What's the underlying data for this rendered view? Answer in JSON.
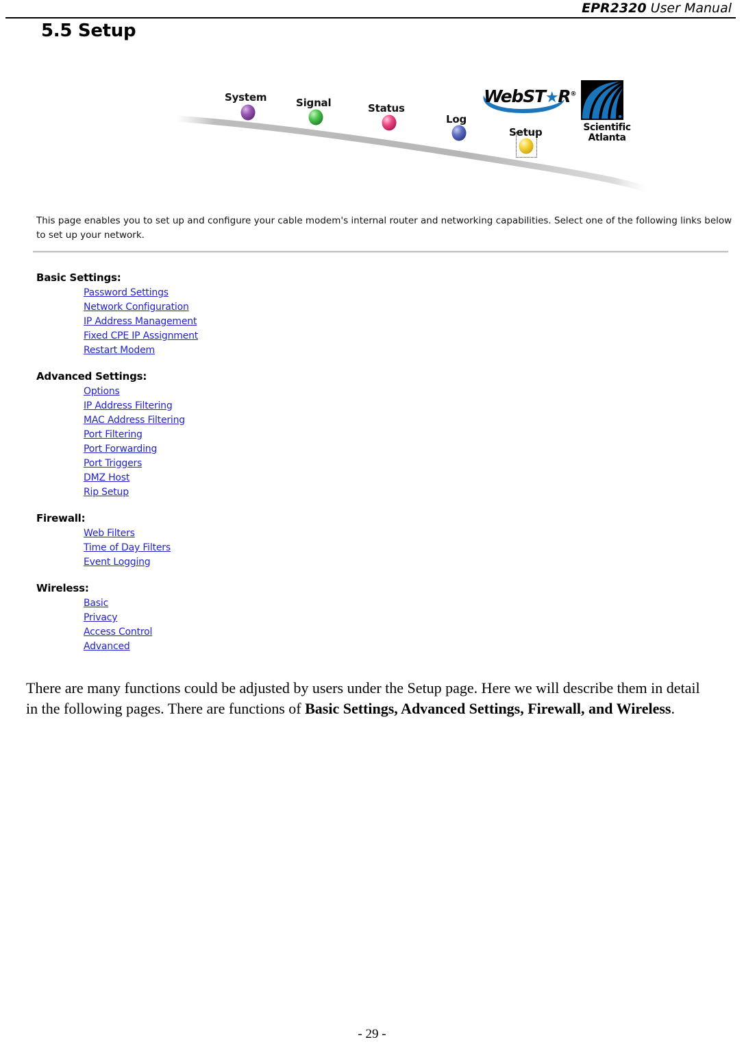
{
  "header": {
    "model": "EPR2320",
    "suffix": " User Manual"
  },
  "page": {
    "section_number_title": "5.5 Setup",
    "footer": "- 29 -"
  },
  "banner": {
    "nav_items": [
      {
        "label": "System",
        "color": "#7a3f96",
        "selected": false
      },
      {
        "label": "Signal",
        "color": "#3fb93f",
        "selected": false
      },
      {
        "label": "Status",
        "color": "#e33d7d",
        "selected": false
      },
      {
        "label": "Log",
        "color": "#5566bb",
        "selected": false
      },
      {
        "label": "Setup",
        "color": "#f2d23a",
        "selected": true
      }
    ],
    "brand_logo": {
      "name": "WebSTAR",
      "text_before_star": "WebST",
      "star": "★",
      "text_after_star": "R",
      "registered": "®"
    },
    "company_logo": {
      "line1": "Scientific",
      "line2": "Atlanta"
    }
  },
  "intro": {
    "text": "This page enables you to set up and configure your cable modem's internal router and networking capabilities.  Select one of the following links below to set up your network."
  },
  "groups": [
    {
      "title": "Basic Settings:",
      "links": [
        "Password Settings",
        "Network Configuration",
        "IP Address Management",
        "Fixed CPE IP Assignment",
        "Restart Modem"
      ]
    },
    {
      "title": "Advanced Settings:",
      "links": [
        "Options",
        "IP Address Filtering",
        "MAC Address Filtering",
        "Port Filtering",
        "Port Forwarding",
        "Port Triggers",
        "DMZ Host",
        "Rip Setup"
      ]
    },
    {
      "title": "Firewall:",
      "links": [
        "Web Filters",
        "Time of Day Filters",
        "Event Logging"
      ]
    },
    {
      "title": "Wireless:",
      "links": [
        "Basic",
        "Privacy",
        "Access Control",
        "Advanced"
      ]
    }
  ],
  "body": {
    "part1": "There are many functions could be adjusted by users under the Setup page. Here we will describe them in detail in the following pages. There are functions of ",
    "bold1": "Basic Settings, Advanced Settings, Firewall, and Wireless",
    "part2": "."
  },
  "colors": {
    "link": "#2222cc",
    "brand_blue": "#1b75bb",
    "rule": "#b9b9b9"
  }
}
